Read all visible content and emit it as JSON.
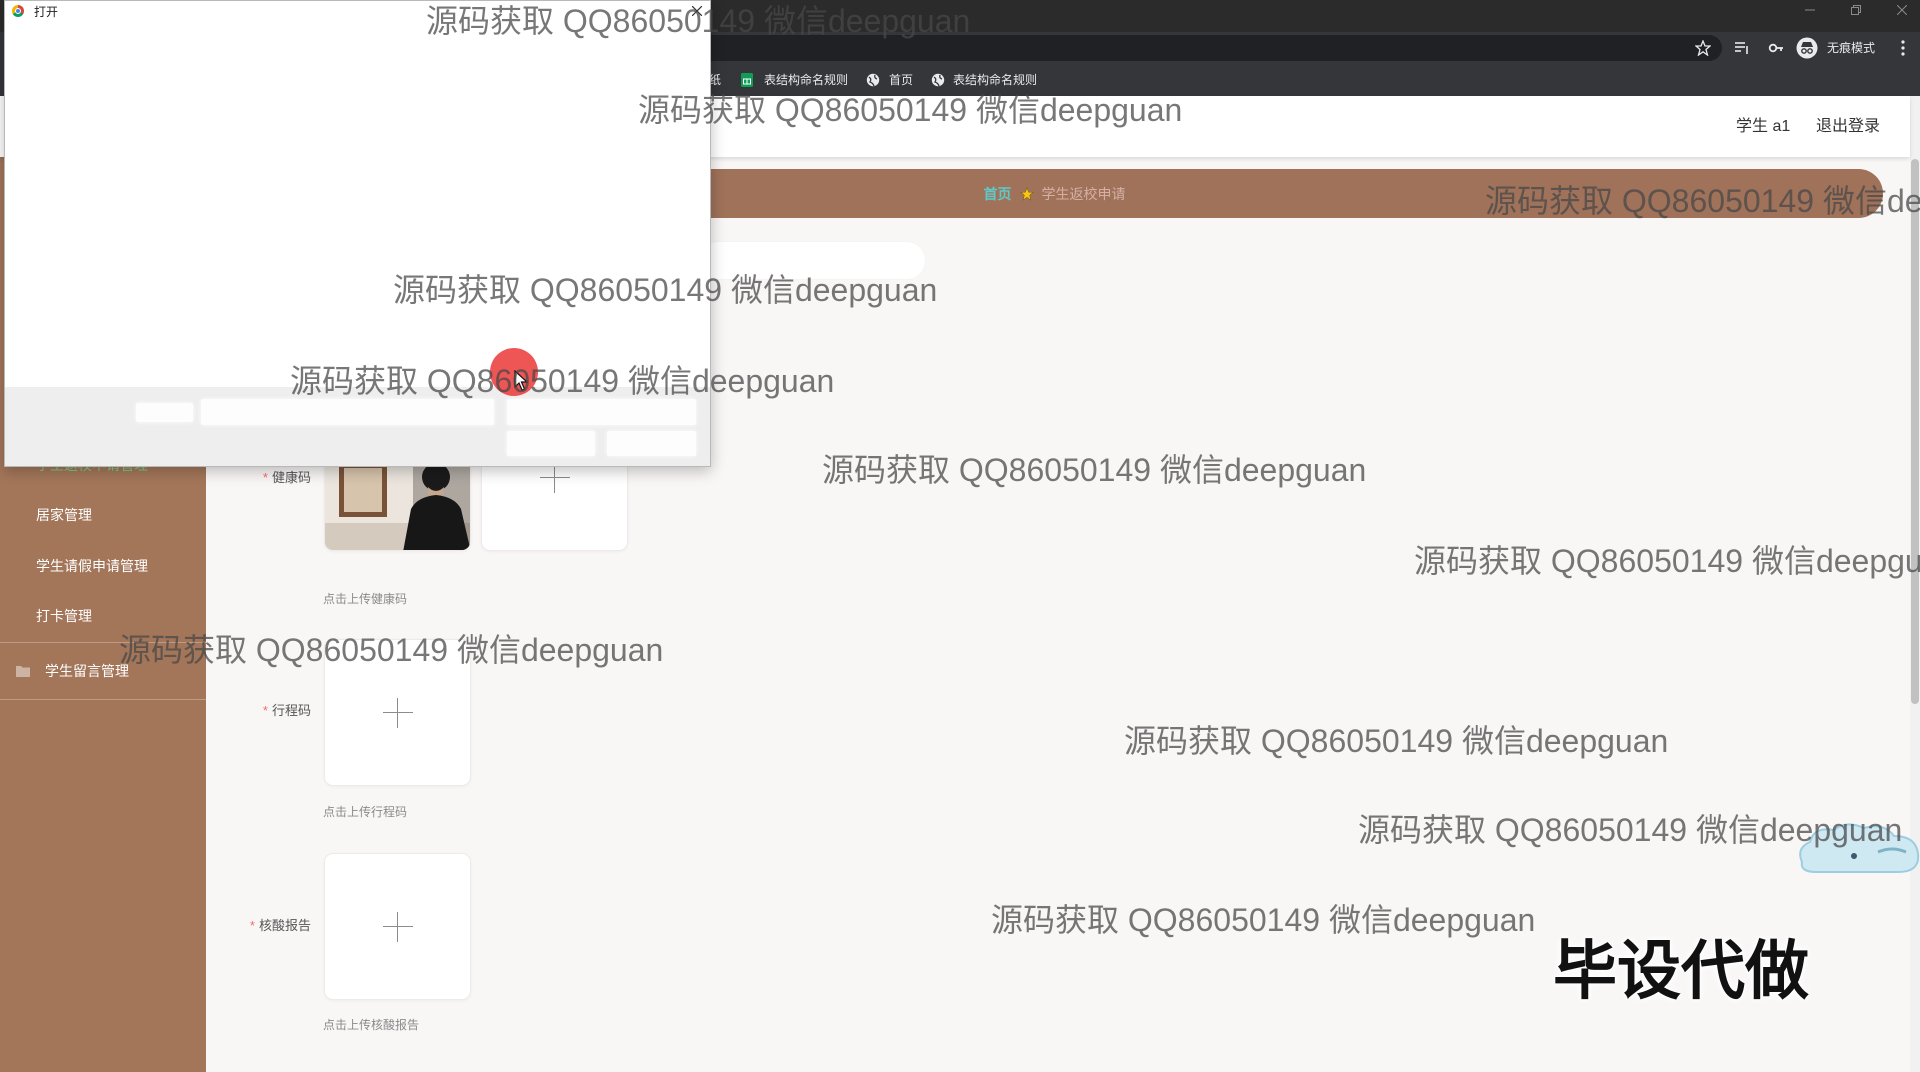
{
  "browser": {
    "profile_label": "无痕模式",
    "toolbar_icons": [
      "bookmark-star-icon",
      "reading-list-icon",
      "password-key-icon",
      "incognito-icon",
      "kebab-menu-icon"
    ],
    "window_controls": [
      "minimize-icon",
      "restore-icon",
      "close-icon"
    ],
    "bookmarks": [
      {
        "label": "纸"
      },
      {
        "label": "表结构命名规则",
        "icon": "sheets-icon"
      },
      {
        "label": "首页",
        "icon": "globe-icon"
      },
      {
        "label": "表结构命名规则",
        "icon": "globe-icon"
      }
    ]
  },
  "dialog": {
    "title": "打开",
    "icon": "chrome-icon"
  },
  "header": {
    "user_label": "学生 a1",
    "logout_label": "退出登录"
  },
  "breadcrumb": {
    "home": "首页",
    "current": "学生返校申请",
    "separator_icon": "star-icon"
  },
  "sidebar": {
    "submenu": [
      "学生返校申请管理",
      "居家管理",
      "学生请假申请管理",
      "打卡管理"
    ],
    "active_index": 0,
    "items": [
      {
        "label": "学生留言管理",
        "icon": "folder-icon"
      }
    ]
  },
  "form": {
    "required_mark": "*",
    "fields": [
      {
        "label": "健康码",
        "hint": "点击上传健康码",
        "uploaded": true
      },
      {
        "label": "行程码",
        "hint": "点击上传行程码",
        "uploaded": false
      },
      {
        "label": "核酸报告",
        "hint": "点击上传核酸报告",
        "uploaded": false
      }
    ]
  },
  "overlay": {
    "watermark": "源码获取 QQ86050149 微信deepguan",
    "promo": "毕设代做"
  },
  "colors": {
    "sidebar": "#a37659",
    "breadcrumb_bar": "#a0725a",
    "active_menu_text": "#7ecb86",
    "breadcrumb_home": "#5ec9c9",
    "required_mark": "#f56c6c",
    "click_highlight": "#ec3e3e"
  }
}
